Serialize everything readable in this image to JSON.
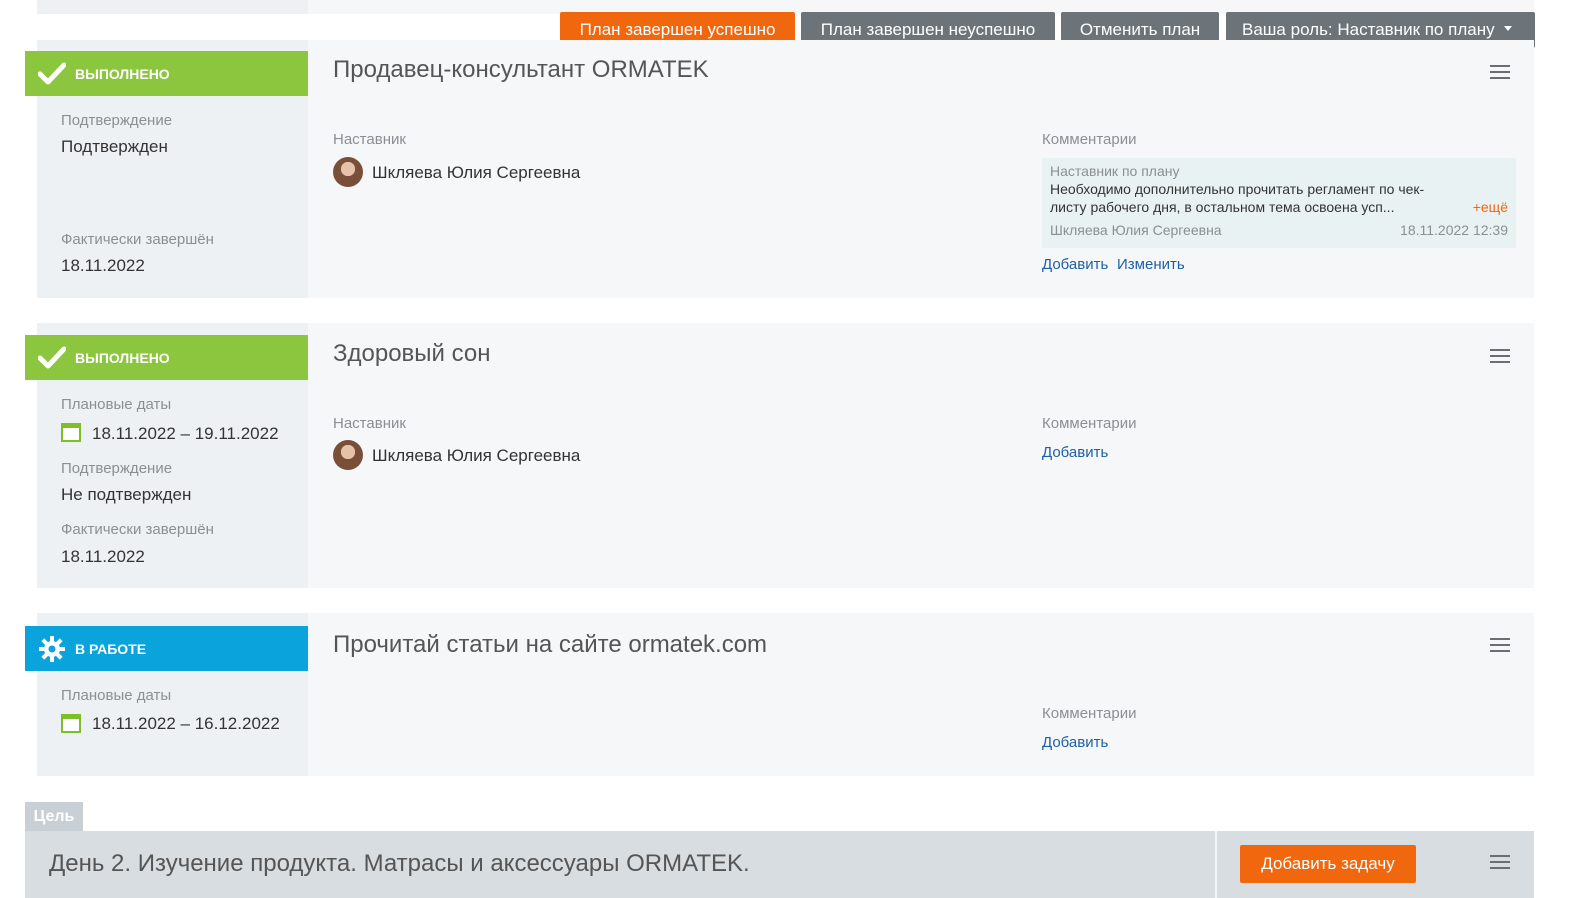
{
  "actions": {
    "success": "План завершен успешно",
    "fail": "План завершен неуспешно",
    "cancel": "Отменить план",
    "role": "Ваша роль: Наставник по плану"
  },
  "tasks": [
    {
      "status": "ВЫПОЛНЕНО",
      "title": "Продавец-консультант ORMATEK",
      "confirm_label": "Подтверждение",
      "confirm_value": "Подтвержден",
      "finished_label": "Фактически завершён",
      "finished_value": "18.11.2022",
      "mentor_label": "Наставник",
      "mentor_name": "Шкляева Юлия Сергеевна",
      "comments_label": "Комментарии",
      "comment": {
        "role": "Наставник по плану",
        "text_line1": "Необходимо дополнительно прочитать регламент по чек-",
        "text_line2": "листу рабочего дня, в остальном тема освоена усп...",
        "more": "+ещё",
        "author": "Шкляева Юлия Сергеевна",
        "date": "18.11.2022 12:39"
      },
      "add": "Добавить",
      "edit": "Изменить"
    },
    {
      "status": "ВЫПОЛНЕНО",
      "title": "Здоровый сон",
      "plan_label": "Плановые даты",
      "plan_value": "18.11.2022 – 19.11.2022",
      "confirm_label": "Подтверждение",
      "confirm_value": "Не подтвержден",
      "finished_label": "Фактически завершён",
      "finished_value": "18.11.2022",
      "mentor_label": "Наставник",
      "mentor_name": "Шкляева Юлия Сергеевна",
      "comments_label": "Комментарии",
      "add": "Добавить"
    },
    {
      "status": "В РАБОТЕ",
      "title": "Прочитай статьи на сайте ormatek.com",
      "plan_label": "Плановые даты",
      "plan_value": "18.11.2022 – 16.12.2022",
      "comments_label": "Комментарии",
      "add": "Добавить"
    }
  ],
  "goal": {
    "tab": "Цель",
    "title": "День 2. Изучение продукта. Матрасы и аксессуары ORMATEK.",
    "add_task": "Добавить задачу"
  },
  "icons": {
    "status_done": "checkmark-icon",
    "status_work": "gear-icon",
    "menu": "hamburger-menu-icon",
    "calendar": "calendar-icon",
    "role_dropdown": "caret-down-icon"
  },
  "colors": {
    "orange": "#f0670e",
    "gray_button": "#6d7479",
    "done_green": "#8cc63f",
    "work_blue": "#0ba3dc",
    "link_blue": "#1d5fa8"
  }
}
